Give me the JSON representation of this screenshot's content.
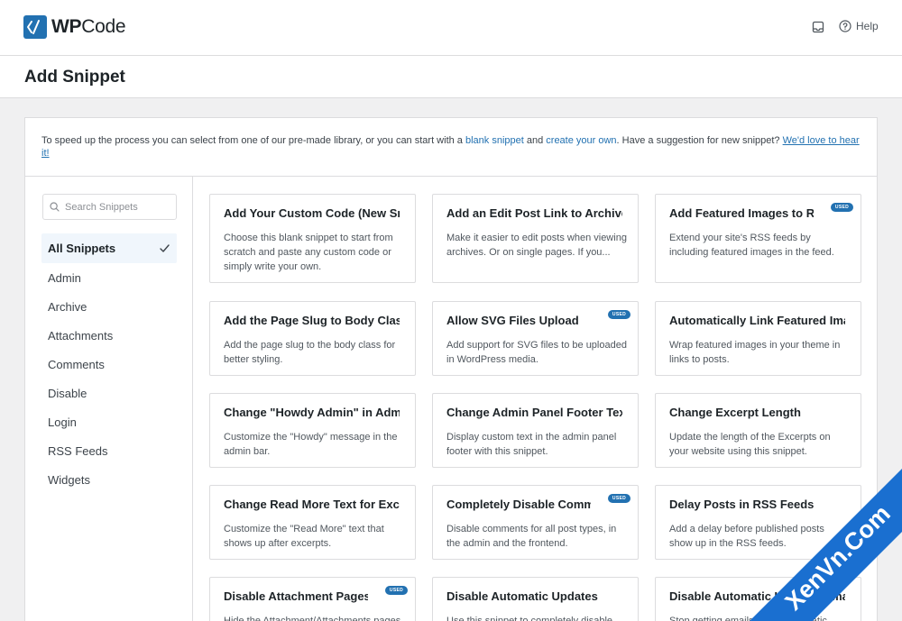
{
  "header": {
    "logo_text_bold": "WP",
    "logo_text_light": "Code",
    "notifications_icon": "inbox-icon",
    "help_label": "Help"
  },
  "page": {
    "title": "Add Snippet"
  },
  "intro": {
    "text_before": "To speed up the process you can select from one of our pre-made library, or you can start with a ",
    "link_blank": "blank snippet",
    "text_and": " and ",
    "link_create": "create your own",
    "text_suggest": ". Have a suggestion for new snippet? ",
    "link_feedback": "We'd love to hear it!"
  },
  "search": {
    "placeholder": "Search Snippets"
  },
  "categories": [
    {
      "label": "All Snippets",
      "active": true
    },
    {
      "label": "Admin"
    },
    {
      "label": "Archive"
    },
    {
      "label": "Attachments"
    },
    {
      "label": "Comments"
    },
    {
      "label": "Disable"
    },
    {
      "label": "Login"
    },
    {
      "label": "RSS Feeds"
    },
    {
      "label": "Widgets"
    }
  ],
  "badge_label": "USED",
  "snippets": [
    {
      "title": "Add Your Custom Code (New Snippet)",
      "desc": "Choose this blank snippet to start from scratch and paste any custom code or simply write your own.",
      "used": false
    },
    {
      "title": "Add an Edit Post Link to Archives",
      "desc": "Make it easier to edit posts when viewing archives. Or on single pages. If you...",
      "used": false
    },
    {
      "title": "Add Featured Images to RSS Feeds",
      "desc": "Extend your site's RSS feeds by including featured images in the feed.",
      "used": true
    },
    {
      "title": "Add the Page Slug to Body Class",
      "desc": "Add the page slug to the body class for better styling.",
      "used": false
    },
    {
      "title": "Allow SVG Files Upload",
      "desc": "Add support for SVG files to be uploaded in WordPress media.",
      "used": true
    },
    {
      "title": "Automatically Link Featured Images to Posts",
      "desc": "Wrap featured images in your theme in links to posts.",
      "used": false
    },
    {
      "title": "Change \"Howdy Admin\" in Admin Bar",
      "desc": "Customize the \"Howdy\" message in the admin bar.",
      "used": false
    },
    {
      "title": "Change Admin Panel Footer Text",
      "desc": "Display custom text in the admin panel footer with this snippet.",
      "used": false
    },
    {
      "title": "Change Excerpt Length",
      "desc": "Update the length of the Excerpts on your website using this snippet.",
      "used": false
    },
    {
      "title": "Change Read More Text for Excerpts",
      "desc": "Customize the \"Read More\" text that shows up after excerpts.",
      "used": false
    },
    {
      "title": "Completely Disable Comments",
      "desc": "Disable comments for all post types, in the admin and the frontend.",
      "used": true
    },
    {
      "title": "Delay Posts in RSS Feeds",
      "desc": "Add a delay before published posts show up in the RSS feeds.",
      "used": false
    },
    {
      "title": "Disable Attachment Pages",
      "desc": "Hide the Attachment/Attachments pages on the frontend.",
      "used": true
    },
    {
      "title": "Disable Automatic Updates",
      "desc": "Use this snippet to completely disable automatic updates on your website.",
      "used": false
    },
    {
      "title": "Disable Automatic Updates Emails",
      "desc": "Stop getting emails about automatic updates on your WordPress site.",
      "used": false
    }
  ],
  "watermark": {
    "text": "XenVn.Com",
    "color": "#1a6fd0"
  }
}
